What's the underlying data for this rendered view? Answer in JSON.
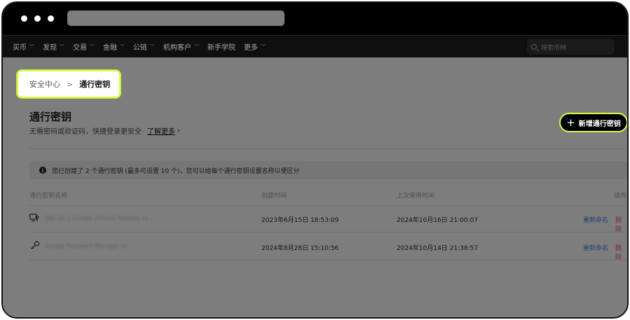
{
  "nav": {
    "items": [
      {
        "label": "买币",
        "has_menu": true
      },
      {
        "label": "发现",
        "has_menu": true
      },
      {
        "label": "交易",
        "has_menu": true
      },
      {
        "label": "金融",
        "has_menu": true
      },
      {
        "label": "公链",
        "has_menu": true
      },
      {
        "label": "机构客户",
        "has_menu": true
      },
      {
        "label": "新手学院",
        "has_menu": false
      },
      {
        "label": "更多",
        "has_menu": true
      }
    ],
    "search_placeholder": "搜索币种"
  },
  "breadcrumb": {
    "home": "安全中心",
    "separator": ">",
    "current": "通行密钥"
  },
  "page": {
    "title": "通行密钥",
    "subtitle": "无需密码或验证码，快捷登录更安全",
    "learn_more": "了解更多",
    "add_button": "新增通行密钥",
    "info": "您已创建了 2 个通行密钥 (最多可设置 10 个)，您可以给每个通行密钥设置名称以便区分"
  },
  "table": {
    "headers": {
      "name": "通行密钥名称",
      "created": "创建时间",
      "last_used": "上次使用时间",
      "actions": "操作"
    },
    "rows": [
      {
        "icon": "device-key-icon",
        "name": "Mac 10.1 Google Chrome Passkey xx",
        "created": "2023年6月15日 18:53:09",
        "last_used": "2024年10月16日 21:00:07",
        "rename": "重新命名",
        "delete": "删除"
      },
      {
        "icon": "key-icon",
        "name": "Google Password Manager xx",
        "created": "2024年8月28日 15:10:56",
        "last_used": "2024年10月14日 21:38:57",
        "rename": "重新命名",
        "delete": "删除"
      }
    ]
  },
  "colors": {
    "accent": "#d6ff45",
    "overlay": "#7d7d7d",
    "frame": "#141414"
  }
}
